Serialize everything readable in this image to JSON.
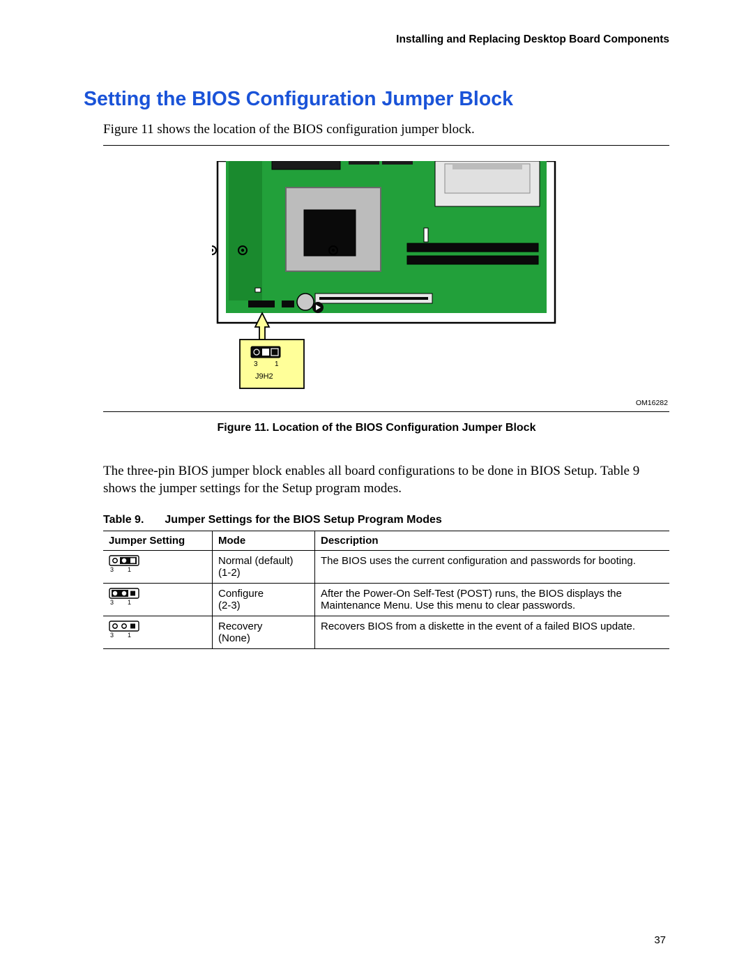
{
  "header": {
    "running_title": "Installing and Replacing Desktop Board Components"
  },
  "section": {
    "title": "Setting the BIOS Configuration Jumper Block",
    "intro": "Figure 11 shows the location of the BIOS configuration jumper block.",
    "after_figure": "The three-pin BIOS jumper block enables all board configurations to be done in BIOS Setup. Table 9 shows the jumper settings for the Setup program modes."
  },
  "figure": {
    "id": "OM16282",
    "caption": "Figure 11.  Location of the BIOS Configuration Jumper Block",
    "callout": {
      "pin3": "3",
      "pin1": "1",
      "label": "J9H2"
    }
  },
  "table": {
    "caption_prefix": "Table 9.",
    "caption_title": "Jumper Settings for the BIOS Setup Program Modes",
    "headers": [
      "Jumper Setting",
      "Mode",
      "Description"
    ],
    "rows": [
      {
        "pins": {
          "left": "3",
          "right": "1"
        },
        "jumper_state": "1-2",
        "mode_line1": "Normal (default)",
        "mode_line2": "(1-2)",
        "desc": "The BIOS uses the current configuration and passwords for booting."
      },
      {
        "pins": {
          "left": "3",
          "right": "1"
        },
        "jumper_state": "2-3",
        "mode_line1": "Configure",
        "mode_line2": "(2-3)",
        "desc": "After the Power-On Self-Test (POST) runs, the BIOS displays the Maintenance Menu.  Use this menu to clear passwords."
      },
      {
        "pins": {
          "left": "3",
          "right": "1"
        },
        "jumper_state": "none",
        "mode_line1": "Recovery",
        "mode_line2": "(None)",
        "desc": "Recovers BIOS from a diskette in the event of a failed BIOS update."
      }
    ]
  },
  "page_number": "37"
}
